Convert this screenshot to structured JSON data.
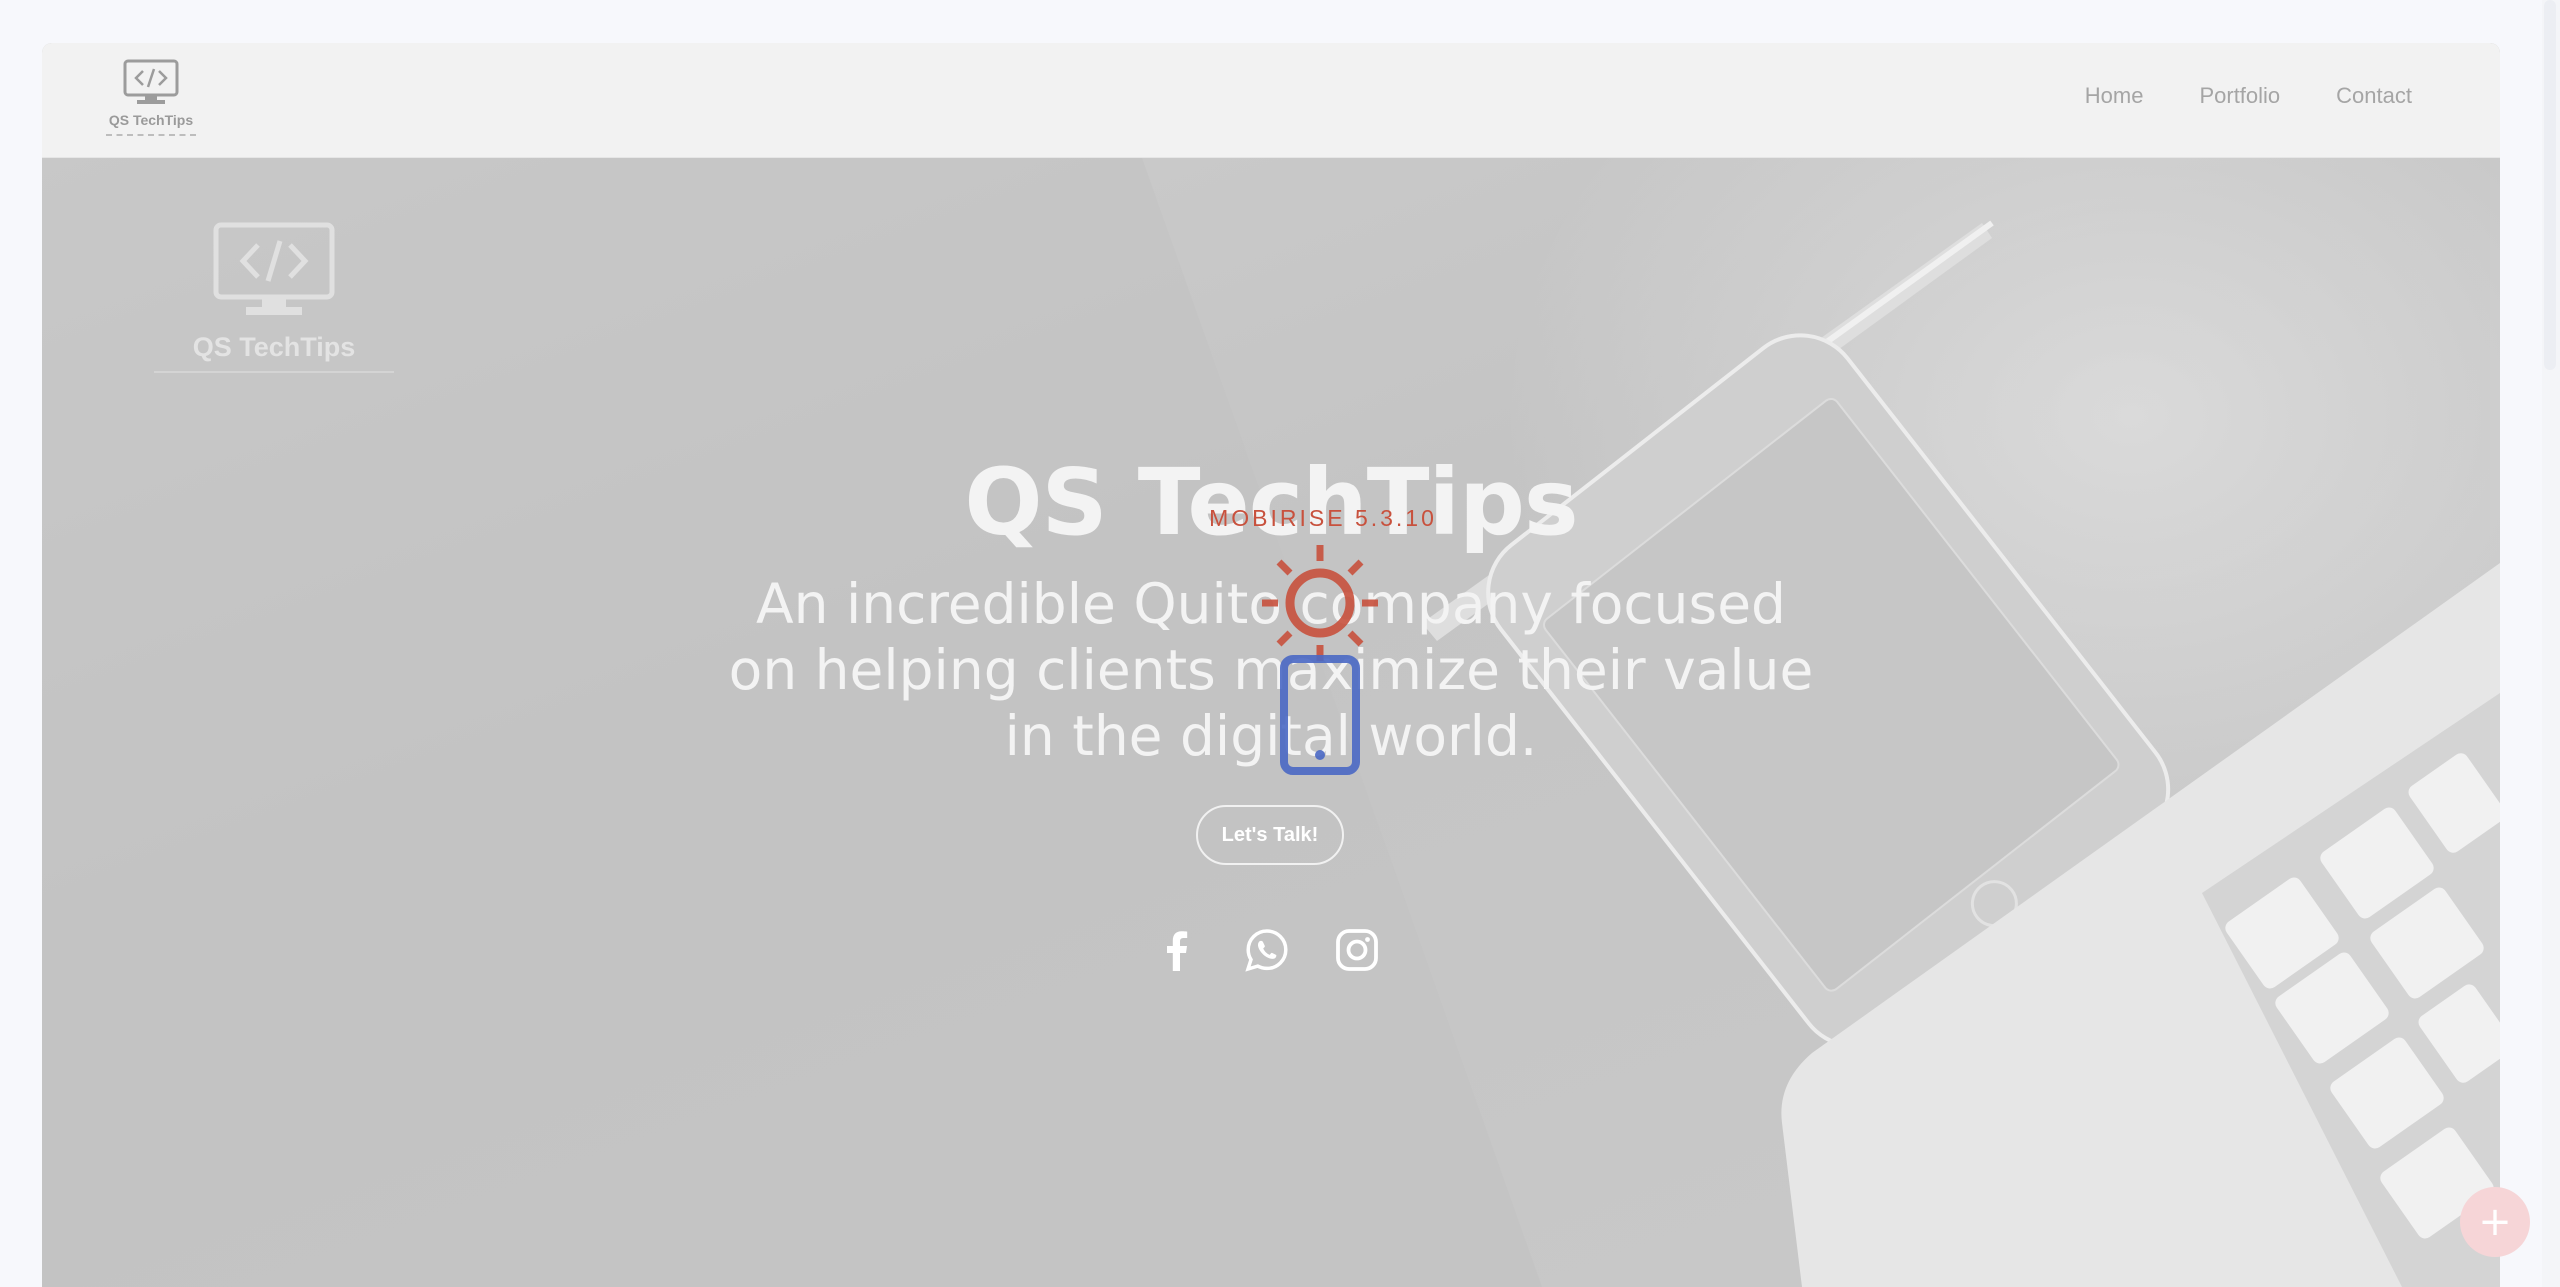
{
  "brand": {
    "name": "QS TechTips"
  },
  "nav": {
    "items": [
      {
        "label": "Home"
      },
      {
        "label": "Portfolio"
      },
      {
        "label": "Contact"
      }
    ]
  },
  "hero": {
    "title": "QS TechTips",
    "subtitle": "An incredible Quito company focused on helping clients maximize their value in the digital world.",
    "cta_label": "Let's Talk!",
    "socials": [
      {
        "icon": "facebook-icon"
      },
      {
        "icon": "whatsapp-icon"
      },
      {
        "icon": "instagram-icon"
      }
    ]
  },
  "loader": {
    "label": "MOBIRISE 5.3.10"
  },
  "fab": {
    "icon": "plus-icon",
    "symbol": "+"
  },
  "colors": {
    "loader_red": "#c8513d",
    "loader_blue": "#4a68c4",
    "fab": "#f6d5d7"
  }
}
